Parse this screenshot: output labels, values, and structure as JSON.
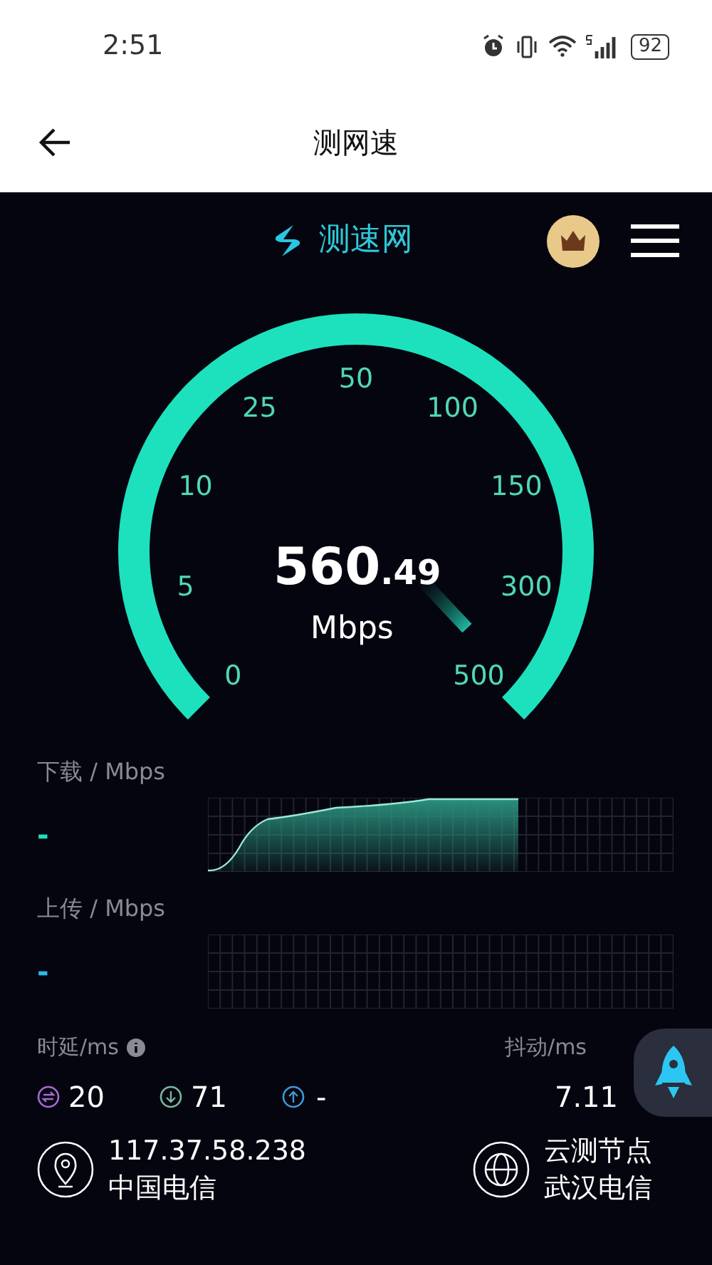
{
  "status_bar": {
    "time": "2:51",
    "battery": "92"
  },
  "header": {
    "title": "测网速"
  },
  "brand": {
    "name": "测速网"
  },
  "gauge": {
    "ticks": [
      "0",
      "5",
      "10",
      "25",
      "50",
      "100",
      "150",
      "300",
      "500"
    ],
    "speed": "560",
    "speed_decimal": ".49",
    "unit": "Mbps"
  },
  "download": {
    "label": "下载 / Mbps",
    "value": "-"
  },
  "upload": {
    "label": "上传 / Mbps",
    "value": "-"
  },
  "latency": {
    "label": "时延/ms",
    "idle": "20",
    "down": "71",
    "up": "-"
  },
  "jitter": {
    "label": "抖动/ms",
    "value": "7.11"
  },
  "client": {
    "ip": "117.37.58.238",
    "isp": "中国电信"
  },
  "server": {
    "label": "云测节点",
    "isp": "武汉电信"
  }
}
